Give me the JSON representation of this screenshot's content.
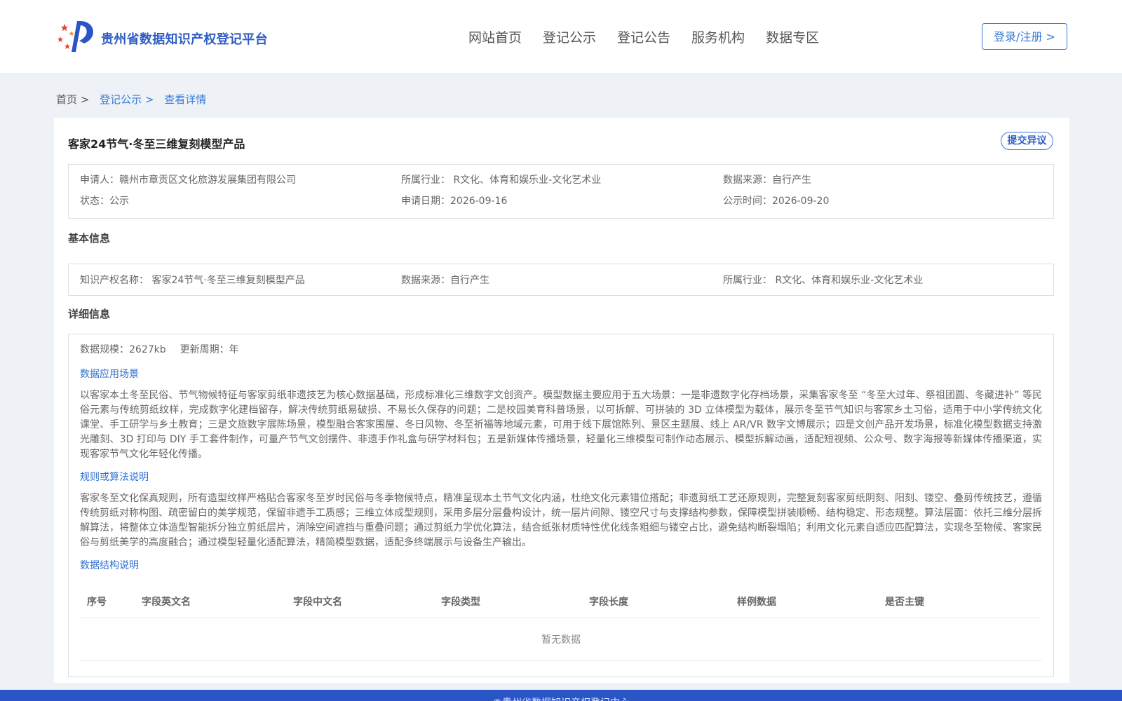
{
  "header": {
    "brand": "贵州省数据知识产权登记平台",
    "nav": [
      "网站首页",
      "登记公示",
      "登记公告",
      "服务机构",
      "数据专区"
    ],
    "login": "登录/注册 >"
  },
  "breadcrumb": [
    "首页 >",
    "登记公示 >",
    "查看详情"
  ],
  "title": "客家24节气·冬至三维复刻模型产品",
  "objection_btn": "提交异议",
  "info": {
    "applicant": "申请人：赣州市章贡区文化旅游发展集团有限公司",
    "industry": "所属行业： R文化、体育和娱乐业-文化艺术业",
    "source": "数据来源：自行产生",
    "status": "状态：公示",
    "apply_date": "申请日期：2026-09-16",
    "publish_time": "公示时间：2026-09-20"
  },
  "basic": {
    "title": "基本信息",
    "ip_name": "知识产权名称： 客家24节气·冬至三维复刻模型产品",
    "source": "数据来源：自行产生",
    "industry": "所属行业： R文化、体育和娱乐业-文化艺术业"
  },
  "detail": {
    "title": "详细信息",
    "scale": "数据规模：2627kb",
    "cycle": "更新周期：年",
    "scenario_title": "数据应用场景",
    "scenario_text": "以客家本土冬至民俗、节气物候特征与客家剪纸非遗技艺为核心数据基础，形成标准化三维数字文创资产。模型数据主要应用于五大场景：一是非遗数字化存档场景，采集客家冬至 “冬至大过年、祭祖团圆、冬藏进补” 等民俗元素与传统剪纸纹样，完成数字化建档留存，解决传统剪纸易破损、不易长久保存的问题；二是校园美育科普场景，以可拆解、可拼装的 3D 立体模型为载体，展示冬至节气知识与客家乡土习俗，适用于中小学传统文化课堂、手工研学与乡土教育；三是文旅数字展陈场景，模型融合客家围屋、冬日风物、冬至祈福等地域元素，可用于线下展馆陈列、景区主题展、线上 AR/VR 数字文博展示；四是文创产品开发场景，标准化模型数据支持激光雕刻、3D 打印与 DIY 手工套件制作，可量产节气文创摆件、非遗手作礼盒与研学材料包；五是新媒体传播场景，轻量化三维模型可制作动态展示、模型拆解动画，适配短视频、公众号、数字海报等新媒体传播渠道，实现客家节气文化年轻化传播。",
    "rules_title": "规则或算法说明",
    "rules_text": "客家冬至文化保真规则，所有造型纹样严格贴合客家冬至岁时民俗与冬季物候特点，精准呈现本土节气文化内涵，杜绝文化元素错位搭配；非遗剪纸工艺还原规则，完整复刻客家剪纸阴刻、阳刻、镂空、叠剪传统技艺，遵循传统剪纸对称构图、疏密留白的美学规范，保留非遗手工质感；三维立体成型规则，采用多层分层叠构设计，统一层片间隙、镂空尺寸与支撑结构参数，保障模型拼装顺畅、结构稳定、形态规整。算法层面：依托三维分层拆解算法，将整体立体造型智能拆分独立剪纸层片，消除空间遮挡与重叠问题；通过剪纸力学优化算法，结合纸张材质特性优化线条粗细与镂空占比，避免结构断裂塌陷；利用文化元素自适应匹配算法，实现冬至物候、客家民俗与剪纸美学的高度融合；通过模型轻量化适配算法，精简模型数据，适配多终端展示与设备生产输出。",
    "structure_title": "数据结构说明",
    "columns": [
      "序号",
      "字段英文名",
      "字段中文名",
      "字段类型",
      "字段长度",
      "样例数据",
      "是否主键"
    ],
    "empty_text": "暂无数据"
  },
  "footer_text": "©贵州省数据知识产权登记中心",
  "colors": {
    "primary": "#2f5cc4",
    "link": "#3a7bd5",
    "footer": "#2a55c7",
    "background": "#eef2f6"
  },
  "icons": {
    "logo": "platform-logo-icon"
  }
}
